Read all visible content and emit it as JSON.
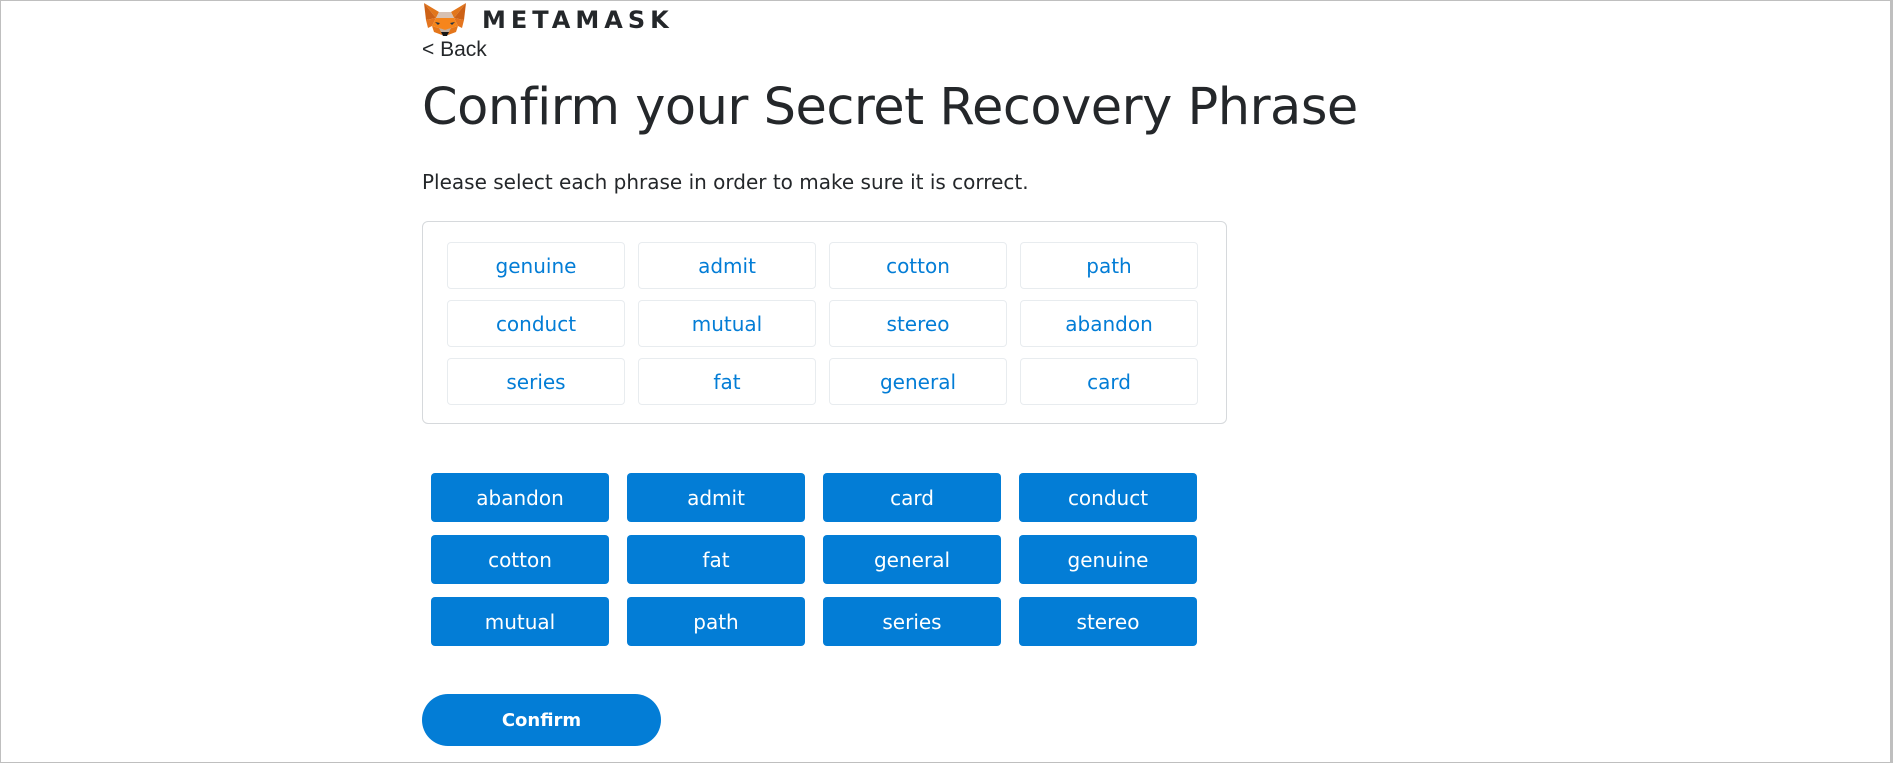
{
  "header": {
    "logo_icon": "metamask-fox-icon",
    "wordmark": "METAMASK",
    "back_label": "< Back"
  },
  "main": {
    "title": "Confirm your Secret Recovery Phrase",
    "instruction": "Please select each phrase in order to make sure it is correct.",
    "selected_words": [
      "genuine",
      "admit",
      "cotton",
      "path",
      "conduct",
      "mutual",
      "stereo",
      "abandon",
      "series",
      "fat",
      "general",
      "card"
    ],
    "word_bank": [
      "abandon",
      "admit",
      "card",
      "conduct",
      "cotton",
      "fat",
      "general",
      "genuine",
      "mutual",
      "path",
      "series",
      "stereo"
    ],
    "confirm_label": "Confirm"
  },
  "colors": {
    "accent": "#037dd6",
    "text": "#24272a",
    "border": "#d6d9dc"
  }
}
